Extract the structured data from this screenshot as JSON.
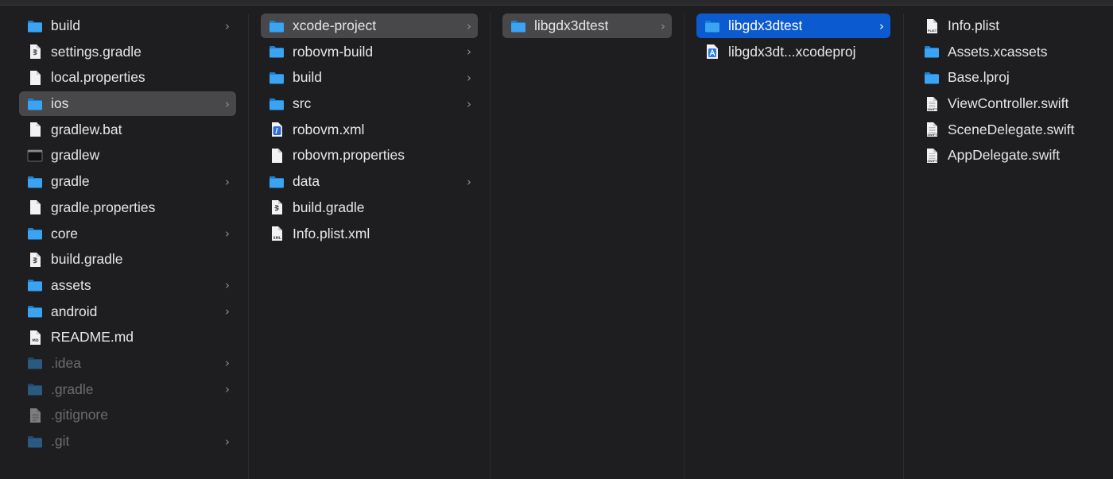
{
  "columns": [
    {
      "id": "col1",
      "items": [
        {
          "label": "build",
          "icon": "folder-icon",
          "folder": true
        },
        {
          "label": "settings.gradle",
          "icon": "gradle-file-icon",
          "folder": false
        },
        {
          "label": "local.properties",
          "icon": "document-icon",
          "folder": false
        },
        {
          "label": "ios",
          "icon": "folder-icon",
          "folder": true,
          "selected": "gray"
        },
        {
          "label": "gradlew.bat",
          "icon": "document-icon",
          "folder": false
        },
        {
          "label": "gradlew",
          "icon": "terminal-exec-icon",
          "folder": false
        },
        {
          "label": "gradle",
          "icon": "folder-icon",
          "folder": true
        },
        {
          "label": "gradle.properties",
          "icon": "document-icon",
          "folder": false
        },
        {
          "label": "core",
          "icon": "folder-icon",
          "folder": true
        },
        {
          "label": "build.gradle",
          "icon": "gradle-file-icon",
          "folder": false
        },
        {
          "label": "assets",
          "icon": "folder-icon",
          "folder": true
        },
        {
          "label": "android",
          "icon": "folder-icon",
          "folder": true
        },
        {
          "label": "README.md",
          "icon": "markdown-file-icon",
          "folder": false
        },
        {
          "label": ".idea",
          "icon": "folder-icon",
          "folder": true,
          "dim": true
        },
        {
          "label": ".gradle",
          "icon": "folder-icon",
          "folder": true,
          "dim": true
        },
        {
          "label": ".gitignore",
          "icon": "text-file-icon",
          "folder": false,
          "dim": true
        },
        {
          "label": ".git",
          "icon": "folder-icon",
          "folder": true,
          "dim": true
        }
      ]
    },
    {
      "id": "col2",
      "items": [
        {
          "label": "xcode-project",
          "icon": "folder-icon",
          "folder": true,
          "selected": "gray"
        },
        {
          "label": "robovm-build",
          "icon": "folder-icon",
          "folder": true
        },
        {
          "label": "build",
          "icon": "folder-icon",
          "folder": true
        },
        {
          "label": "src",
          "icon": "folder-icon",
          "folder": true
        },
        {
          "label": "robovm.xml",
          "icon": "xml-file-icon",
          "folder": false
        },
        {
          "label": "robovm.properties",
          "icon": "document-icon",
          "folder": false
        },
        {
          "label": "data",
          "icon": "folder-icon",
          "folder": true
        },
        {
          "label": "build.gradle",
          "icon": "gradle-file-icon",
          "folder": false
        },
        {
          "label": "Info.plist.xml",
          "icon": "xml-doc-icon",
          "folder": false
        }
      ]
    },
    {
      "id": "col3",
      "items": [
        {
          "label": "libgdx3dtest",
          "icon": "folder-icon",
          "folder": true,
          "selected": "gray"
        }
      ]
    },
    {
      "id": "col4",
      "items": [
        {
          "label": "libgdx3dtest",
          "icon": "folder-icon",
          "folder": true,
          "selected": "blue"
        },
        {
          "label": "libgdx3dt...xcodeproj",
          "icon": "xcodeproj-icon",
          "folder": false
        }
      ]
    },
    {
      "id": "col5",
      "items": [
        {
          "label": "Info.plist",
          "icon": "plist-file-icon",
          "folder": false
        },
        {
          "label": "Assets.xcassets",
          "icon": "folder-icon",
          "folder": false
        },
        {
          "label": "Base.lproj",
          "icon": "folder-icon",
          "folder": false
        },
        {
          "label": "ViewController.swift",
          "icon": "swift-file-icon",
          "folder": false
        },
        {
          "label": "SceneDelegate.swift",
          "icon": "swift-file-icon",
          "folder": false
        },
        {
          "label": "AppDelegate.swift",
          "icon": "swift-file-icon",
          "folder": false
        }
      ]
    }
  ],
  "chevron": "›",
  "colors": {
    "background": "#1e1e20",
    "folder": "#2f9cf0",
    "selection_gray": "#48484a",
    "selection_blue": "#0b5ad0"
  }
}
